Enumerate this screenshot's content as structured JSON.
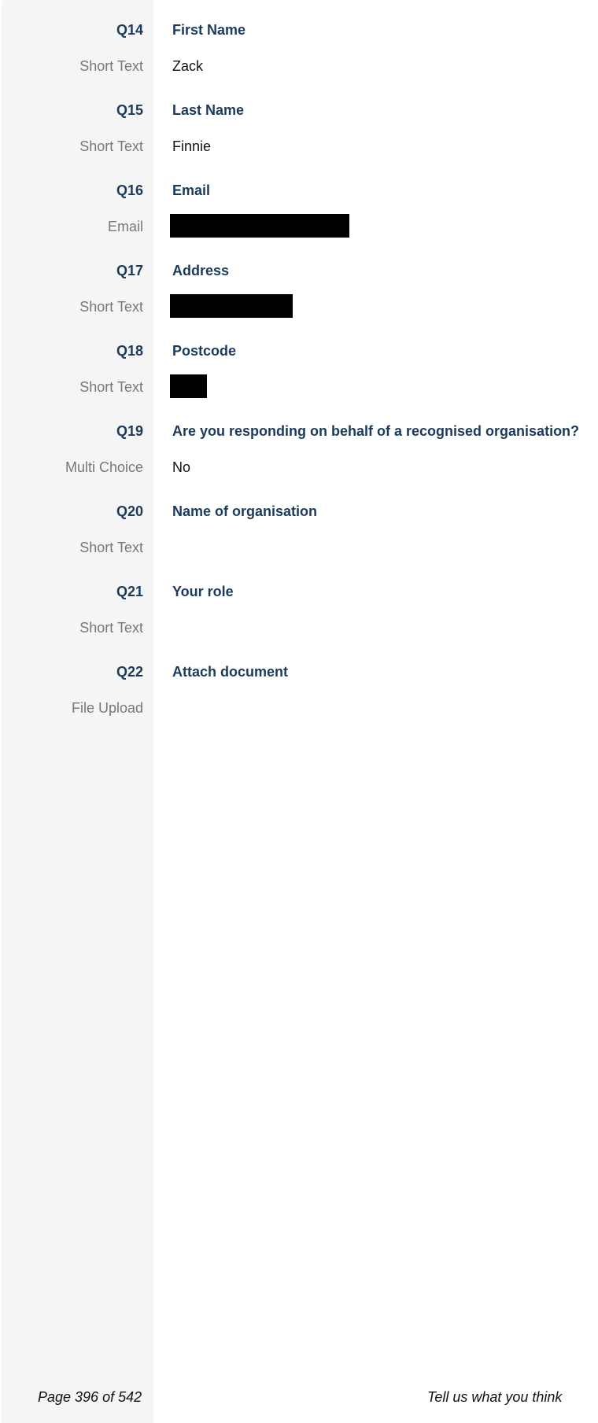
{
  "questions": [
    {
      "number": "Q14",
      "type": "Short Text",
      "title": "First Name",
      "answer": "Zack"
    },
    {
      "number": "Q15",
      "type": "Short Text",
      "title": "Last Name",
      "answer": "Finnie"
    },
    {
      "number": "Q16",
      "type": "Email",
      "title": "Email",
      "answer": ""
    },
    {
      "number": "Q17",
      "type": "Short Text",
      "title": "Address",
      "answer": ""
    },
    {
      "number": "Q18",
      "type": "Short Text",
      "title": "Postcode",
      "answer": ""
    },
    {
      "number": "Q19",
      "type": "Multi Choice",
      "title": "Are you responding on behalf of a recognised organisation?",
      "answer": "No"
    },
    {
      "number": "Q20",
      "type": "Short Text",
      "title": "Name of organisation",
      "answer": ""
    },
    {
      "number": "Q21",
      "type": "Short Text",
      "title": "Your role",
      "answer": ""
    },
    {
      "number": "Q22",
      "type": "File Upload",
      "title": "Attach document",
      "answer": ""
    }
  ],
  "footer": {
    "page": "Page 396 of 542",
    "feedback": "Tell us what you think"
  }
}
